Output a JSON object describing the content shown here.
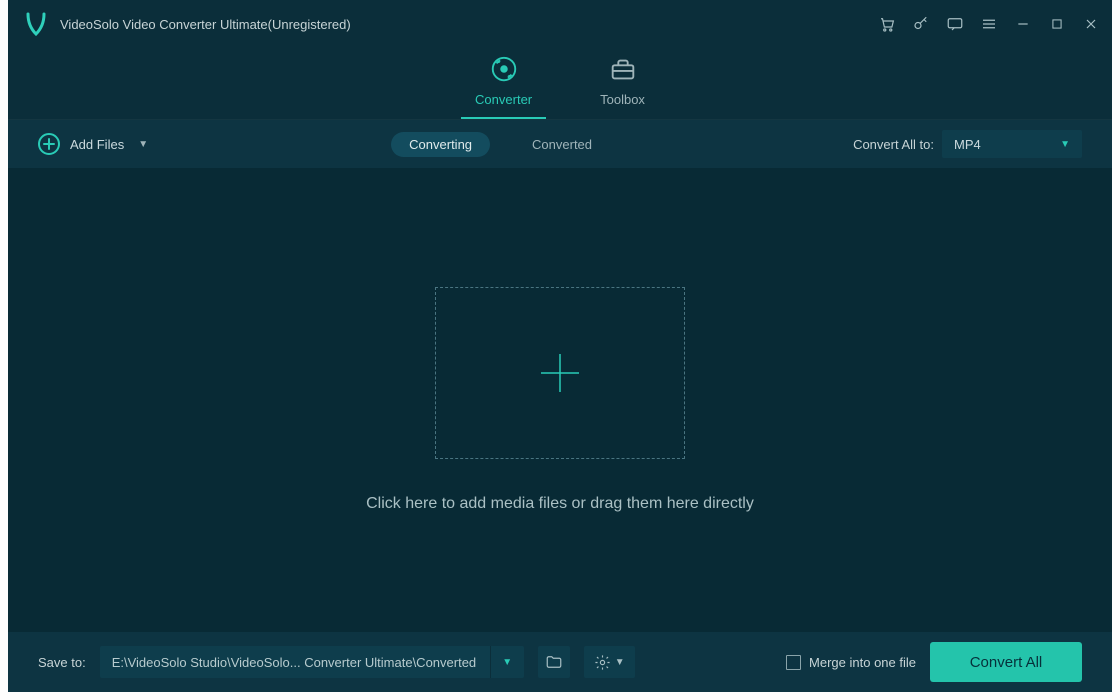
{
  "app": {
    "title": "VideoSolo Video Converter Ultimate(Unregistered)"
  },
  "mainTabs": {
    "converter": "Converter",
    "toolbox": "Toolbox"
  },
  "toolbar": {
    "addFiles": "Add Files",
    "converting": "Converting",
    "converted": "Converted",
    "convertAllTo": "Convert All to:",
    "format": "MP4"
  },
  "dropzone": {
    "hint": "Click here to add media files or drag them here directly"
  },
  "bottom": {
    "saveTo": "Save to:",
    "path": "E:\\VideoSolo Studio\\VideoSolo... Converter Ultimate\\Converted",
    "merge": "Merge into one file",
    "convertAll": "Convert All"
  }
}
